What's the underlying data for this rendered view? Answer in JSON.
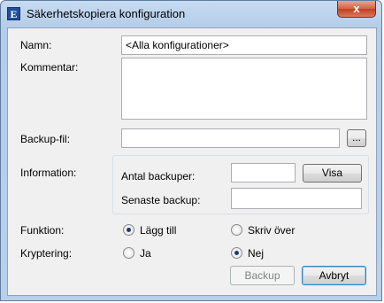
{
  "window": {
    "title": "Säkerhetskopiera konfiguration",
    "app_icon_letter": "E",
    "close_label": "x"
  },
  "form": {
    "name_label": "Namn:",
    "name_value": "<Alla konfigurationer>",
    "comment_label": "Kommentar:",
    "comment_value": "",
    "backup_file_label": "Backup-fil:",
    "backup_file_value": "",
    "browse_label": "...",
    "information_label": "Information:",
    "backup_count_label": "Antal backuper:",
    "backup_count_value": "",
    "show_label": "Visa",
    "latest_backup_label": "Senaste backup:",
    "latest_backup_value": "",
    "function_label": "Funktion:",
    "function_options": [
      {
        "label": "Lägg till",
        "checked": true
      },
      {
        "label": "Skriv över",
        "checked": false
      }
    ],
    "encryption_label": "Kryptering:",
    "encryption_options": [
      {
        "label": "Ja",
        "checked": false
      },
      {
        "label": "Nej",
        "checked": true
      }
    ]
  },
  "buttons": {
    "backup_label": "Backup",
    "backup_enabled": false,
    "cancel_label": "Avbryt"
  }
}
